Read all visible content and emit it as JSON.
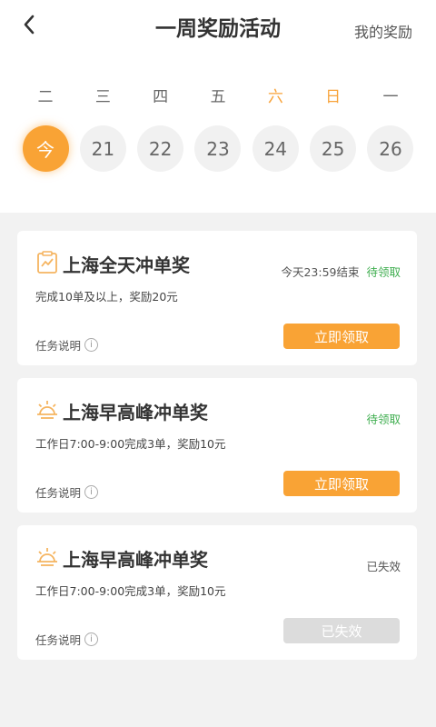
{
  "header": {
    "title": "一周奖励活动",
    "my_rewards": "我的奖励"
  },
  "week": [
    {
      "weekday": "二",
      "date": "今",
      "today": true,
      "weekend": false
    },
    {
      "weekday": "三",
      "date": "21",
      "today": false,
      "weekend": false
    },
    {
      "weekday": "四",
      "date": "22",
      "today": false,
      "weekend": false
    },
    {
      "weekday": "五",
      "date": "23",
      "today": false,
      "weekend": false
    },
    {
      "weekday": "六",
      "date": "24",
      "today": false,
      "weekend": true
    },
    {
      "weekday": "日",
      "date": "25",
      "today": false,
      "weekend": true
    },
    {
      "weekday": "一",
      "date": "26",
      "today": false,
      "weekend": false
    }
  ],
  "cards": [
    {
      "icon": "chart-clipboard-icon",
      "title": "上海全天冲单奖",
      "status_time": "今天23:59结束",
      "status": "待领取",
      "desc": "完成10单及以上，奖励20元",
      "task_info": "任务说明",
      "button": "立即领取",
      "button_active": true
    },
    {
      "icon": "sunrise-icon",
      "title": "上海早高峰冲单奖",
      "status_time": "",
      "status": "待领取",
      "desc": "工作日7:00-9:00完成3单，奖励10元",
      "task_info": "任务说明",
      "button": "立即领取",
      "button_active": true
    },
    {
      "icon": "sunrise-icon",
      "title": "上海早高峰冲单奖",
      "status_time": "",
      "status": "已失效",
      "desc": "工作日7:00-9:00完成3单，奖励10元",
      "task_info": "任务说明",
      "button": "已失效",
      "button_active": false
    }
  ],
  "colors": {
    "accent": "#f9a335",
    "pending": "#3fae4f",
    "background": "#f2f2f2"
  }
}
